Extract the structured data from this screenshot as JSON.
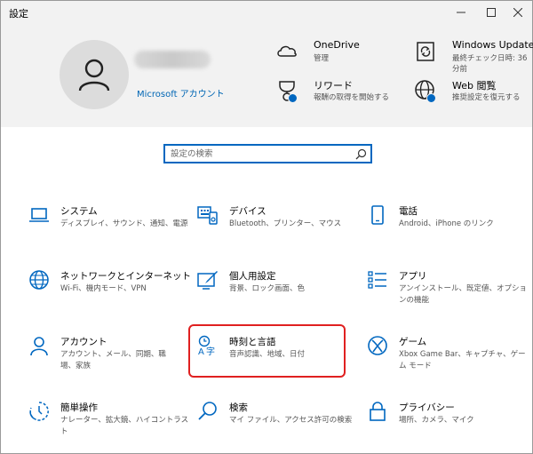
{
  "window": {
    "title": "設定"
  },
  "header": {
    "account_link": "Microsoft アカウント",
    "items": [
      {
        "title": "OneDrive",
        "sub": "管理"
      },
      {
        "title": "Windows Update",
        "sub": "最終チェック日時: 36 分前"
      },
      {
        "title": "リワード",
        "sub": "報酬の取得を開始する"
      },
      {
        "title": "Web 閲覧",
        "sub": "推奨設定を復元する"
      }
    ]
  },
  "search": {
    "placeholder": "設定の検索"
  },
  "categories": [
    {
      "title": "システム",
      "sub": "ディスプレイ、サウンド、通知、電源",
      "icon": "laptop-icon"
    },
    {
      "title": "デバイス",
      "sub": "Bluetooth、プリンター、マウス",
      "icon": "keyboard-icon"
    },
    {
      "title": "電話",
      "sub": "Android、iPhone のリンク",
      "icon": "phone-icon"
    },
    {
      "title": "ネットワークとインターネット",
      "sub": "Wi-Fi、機内モード、VPN",
      "icon": "globe-icon"
    },
    {
      "title": "個人用設定",
      "sub": "背景、ロック画面、色",
      "icon": "paint-icon"
    },
    {
      "title": "アプリ",
      "sub": "アンインストール、既定値、オプションの機能",
      "icon": "apps-list-icon"
    },
    {
      "title": "アカウント",
      "sub": "アカウント、メール、同期、職場、家族",
      "icon": "person-icon"
    },
    {
      "title": "時刻と言語",
      "sub": "音声認識、地域、日付",
      "icon": "time-language-icon"
    },
    {
      "title": "ゲーム",
      "sub": "Xbox Game Bar、キャプチャ、ゲーム モード",
      "icon": "xbox-icon"
    },
    {
      "title": "簡単操作",
      "sub": "ナレーター、拡大鏡、ハイコントラスト",
      "icon": "ease-of-access-icon"
    },
    {
      "title": "検索",
      "sub": "マイ ファイル、アクセス許可の検索",
      "icon": "search-icon"
    },
    {
      "title": "プライバシー",
      "sub": "場所、カメラ、マイク",
      "icon": "lock-icon"
    }
  ],
  "colors": {
    "accent": "#0067c0",
    "highlight": "#e02020",
    "header_bg": "#f2f2f2"
  }
}
